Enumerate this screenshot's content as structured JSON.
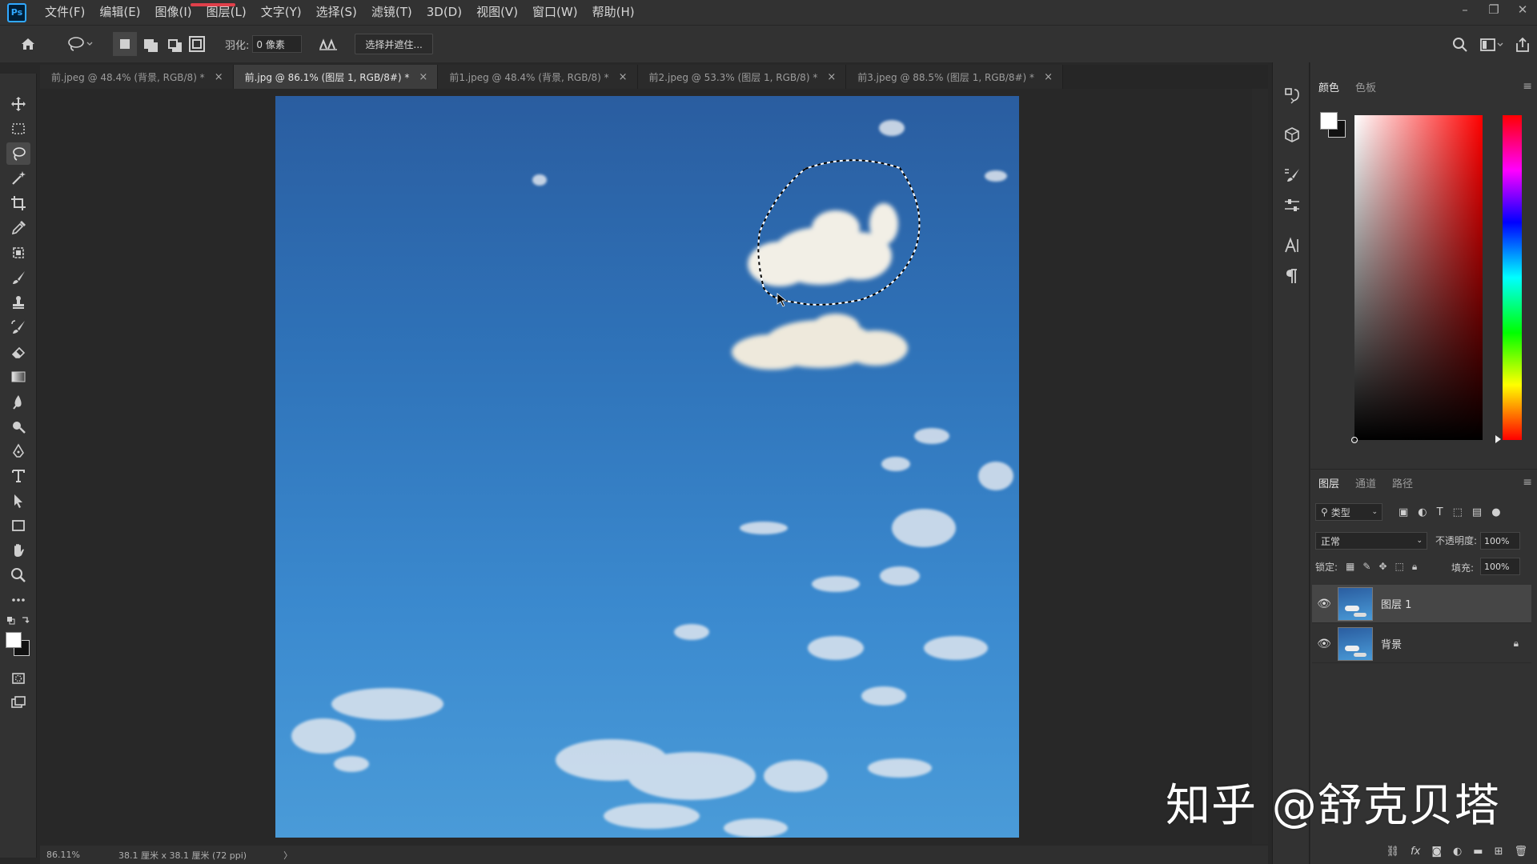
{
  "app": {
    "logo_text": "Ps"
  },
  "menu": {
    "items": [
      "文件(F)",
      "编辑(E)",
      "图像(I)",
      "图层(L)",
      "文字(Y)",
      "选择(S)",
      "滤镜(T)",
      "3D(D)",
      "视图(V)",
      "窗口(W)",
      "帮助(H)"
    ]
  },
  "window_controls": {
    "minimize": "–",
    "restore": "❐",
    "close": "✕"
  },
  "options": {
    "feather_label": "羽化:",
    "feather_value": "0 像素",
    "select_mask_label": "选择并遮住..."
  },
  "tabs": [
    {
      "label": "前.jpeg @ 48.4% (背景, RGB/8) *",
      "active": false
    },
    {
      "label": "前.jpg @ 86.1% (图层 1, RGB/8#) *",
      "active": true
    },
    {
      "label": "前1.jpeg @ 48.4% (背景, RGB/8) *",
      "active": false
    },
    {
      "label": "前2.jpeg @ 53.3% (图层 1, RGB/8) *",
      "active": false
    },
    {
      "label": "前3.jpeg @ 88.5% (图层 1, RGB/8#) *",
      "active": false
    }
  ],
  "tab_close_glyph": "×",
  "status": {
    "zoom": "86.11%",
    "doc_size": "38.1 厘米 x 38.1 厘米 (72 ppi)",
    "arrow": "〉"
  },
  "color_panel": {
    "tabs": [
      "颜色",
      "色板"
    ],
    "foreground": "#ffffff",
    "background": "#111111"
  },
  "layers_panel": {
    "tabs": [
      "图层",
      "通道",
      "路径"
    ],
    "filter_label": "类型",
    "blend_mode": "正常",
    "opacity_label": "不透明度:",
    "opacity_value": "100%",
    "lock_label": "锁定:",
    "fill_label": "填充:",
    "fill_value": "100%",
    "layers": [
      {
        "name": "图层 1",
        "selected": true,
        "locked": false
      },
      {
        "name": "背景",
        "selected": false,
        "locked": true
      }
    ]
  },
  "watermark": "知乎 @舒克贝塔"
}
